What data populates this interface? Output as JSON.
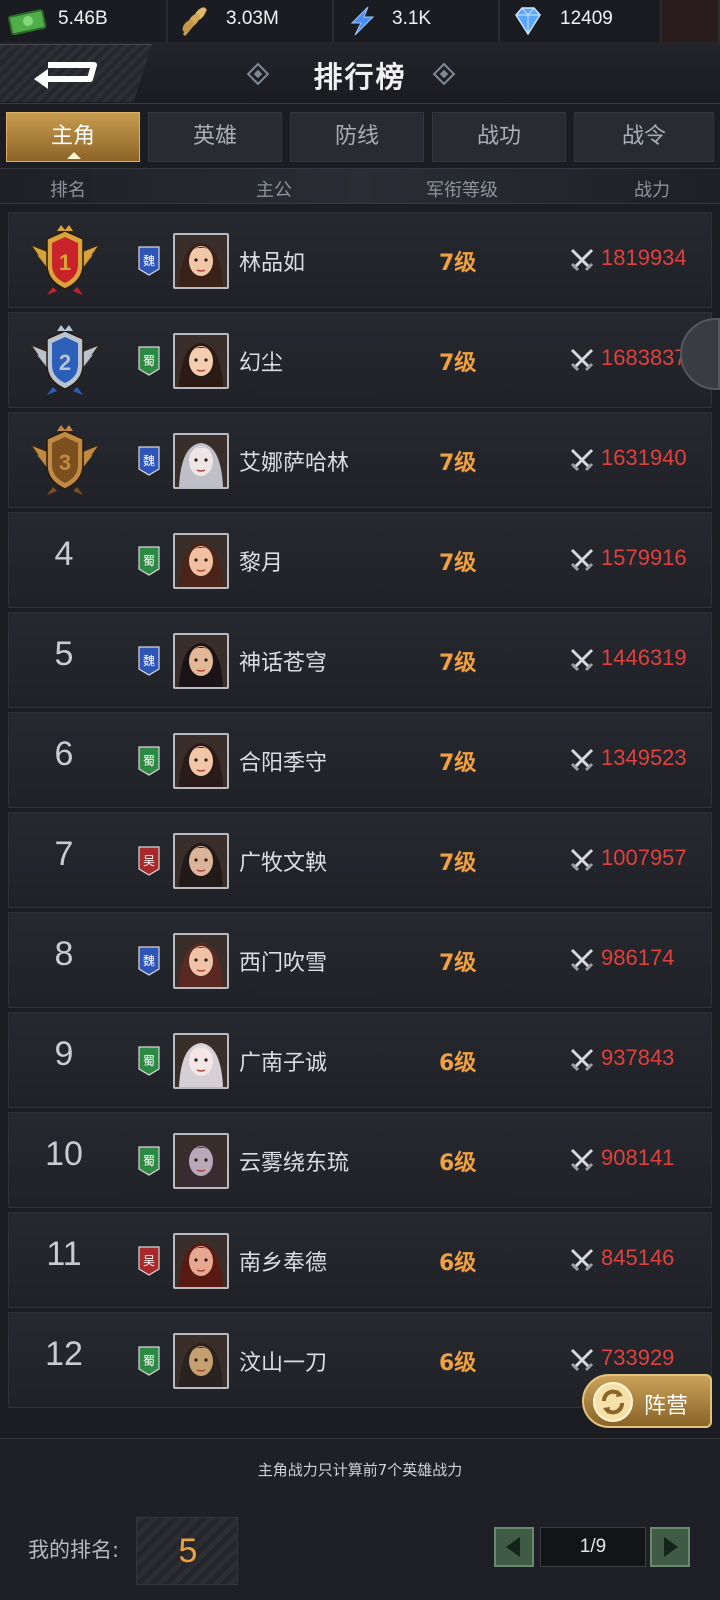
{
  "resources": [
    {
      "icon": "cash-icon",
      "value": "5.46B"
    },
    {
      "icon": "wheat-icon",
      "value": "3.03M"
    },
    {
      "icon": "lightning-icon",
      "value": "3.1K"
    },
    {
      "icon": "diamond-icon",
      "value": "12409"
    }
  ],
  "header": {
    "title": "排行榜"
  },
  "tabs": [
    {
      "label": "主角",
      "active": true
    },
    {
      "label": "英雄",
      "active": false
    },
    {
      "label": "防线",
      "active": false
    },
    {
      "label": "战功",
      "active": false
    },
    {
      "label": "战令",
      "active": false
    }
  ],
  "columns": {
    "rank": "排名",
    "lord": "主公",
    "title_level": "军衔等级",
    "power": "战力"
  },
  "rows": [
    {
      "rank": "1",
      "faction": "魏",
      "name": "林品如",
      "level": "7级",
      "power": "1819934"
    },
    {
      "rank": "2",
      "faction": "蜀",
      "name": "幻尘",
      "level": "7级",
      "power": "1683837"
    },
    {
      "rank": "3",
      "faction": "魏",
      "name": "艾娜萨哈林",
      "level": "7级",
      "power": "1631940"
    },
    {
      "rank": "4",
      "faction": "蜀",
      "name": "黎月",
      "level": "7级",
      "power": "1579916"
    },
    {
      "rank": "5",
      "faction": "魏",
      "name": "神话苍穹",
      "level": "7级",
      "power": "1446319"
    },
    {
      "rank": "6",
      "faction": "蜀",
      "name": "合阳季守",
      "level": "7级",
      "power": "1349523"
    },
    {
      "rank": "7",
      "faction": "吴",
      "name": "广牧文鞅",
      "level": "7级",
      "power": "1007957"
    },
    {
      "rank": "8",
      "faction": "魏",
      "name": "西门吹雪",
      "level": "7级",
      "power": "986174"
    },
    {
      "rank": "9",
      "faction": "蜀",
      "name": "广南子诚",
      "level": "6级",
      "power": "937843"
    },
    {
      "rank": "10",
      "faction": "蜀",
      "name": "云雾绕东琉",
      "level": "6级",
      "power": "908141"
    },
    {
      "rank": "11",
      "faction": "吴",
      "name": "南乡奉德",
      "level": "6级",
      "power": "845146"
    },
    {
      "rank": "12",
      "faction": "蜀",
      "name": "汶山一刀",
      "level": "6级",
      "power": "733929"
    }
  ],
  "faction_colors": {
    "魏": "#2f55b8",
    "蜀": "#2c8a45",
    "吴": "#a8292b"
  },
  "camp_button": {
    "label": "阵营"
  },
  "footer": {
    "note": "主角战力只计算前7个英雄战力",
    "my_rank_label": "我的排名:",
    "my_rank_value": "5",
    "page_indicator": "1/9"
  }
}
